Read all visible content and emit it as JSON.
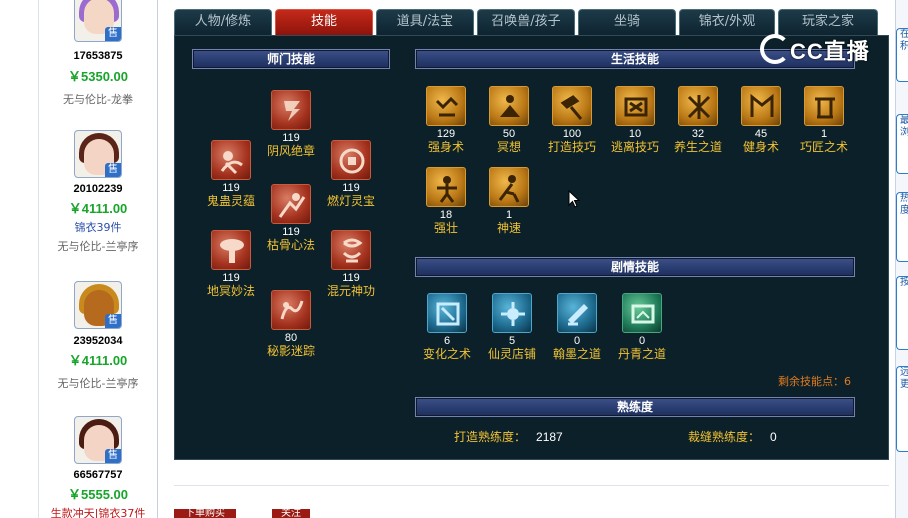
{
  "listings": [
    {
      "id": "17653875",
      "price": "￥5350.00",
      "extra": "",
      "server": "无与伦比-龙拳",
      "sell": "售"
    },
    {
      "id": "20102239",
      "price": "￥4111.00",
      "extra": "锦衣39件",
      "server": "无与伦比-兰亭序",
      "sell": "售"
    },
    {
      "id": "23952034",
      "price": "￥4111.00",
      "extra": "",
      "server": "无与伦比-兰亭序",
      "sell": "售"
    },
    {
      "id": "66567757",
      "price": "￥5555.00",
      "extra": "生款冲天|锦衣37件",
      "server": "",
      "sell": "售"
    }
  ],
  "tabs": [
    "人物/修炼",
    "技能",
    "道具/法宝",
    "召唤兽/孩子",
    "坐骑",
    "锦衣/外观",
    "玩家之家"
  ],
  "active_tab": "技能",
  "watermark": "CC直播",
  "sections": {
    "school": "师门技能",
    "life": "生活技能",
    "story": "剧情技能",
    "proficiency": "熟练度"
  },
  "school_skills": [
    {
      "name": "阴风绝章",
      "level": "119"
    },
    {
      "name": "鬼蛊灵蕴",
      "level": "119"
    },
    {
      "name": "燃灯灵宝",
      "level": "119"
    },
    {
      "name": "枯骨心法",
      "level": "119"
    },
    {
      "name": "地冥妙法",
      "level": "119"
    },
    {
      "name": "混元神功",
      "level": "119"
    },
    {
      "name": "秘影迷踪",
      "level": "80"
    }
  ],
  "life_skills": [
    {
      "name": "强身术",
      "level": "129"
    },
    {
      "name": "冥想",
      "level": "50"
    },
    {
      "name": "打造技巧",
      "level": "100"
    },
    {
      "name": "逃离技巧",
      "level": "10"
    },
    {
      "name": "养生之道",
      "level": "32"
    },
    {
      "name": "健身术",
      "level": "45"
    },
    {
      "name": "巧匠之术",
      "level": "1"
    },
    {
      "name": "强壮",
      "level": "18"
    },
    {
      "name": "神速",
      "level": "1"
    }
  ],
  "story_skills": [
    {
      "name": "变化之术",
      "level": "6"
    },
    {
      "name": "仙灵店铺",
      "level": "5"
    },
    {
      "name": "翰墨之道",
      "level": "0"
    },
    {
      "name": "丹青之道",
      "level": "0"
    }
  ],
  "remaining_points": "剩余技能点：6",
  "proficiency": {
    "forge_label": "打造熟练度：",
    "forge_value": "2187",
    "tailor_label": "裁缝熟练度：",
    "tailor_value": "0"
  },
  "right_strip": [
    "在",
    "积",
    "最",
    "浏",
    "热",
    "度",
    "按",
    "远",
    "更"
  ],
  "bottom_buttons": [
    "下单购买",
    "关注"
  ]
}
